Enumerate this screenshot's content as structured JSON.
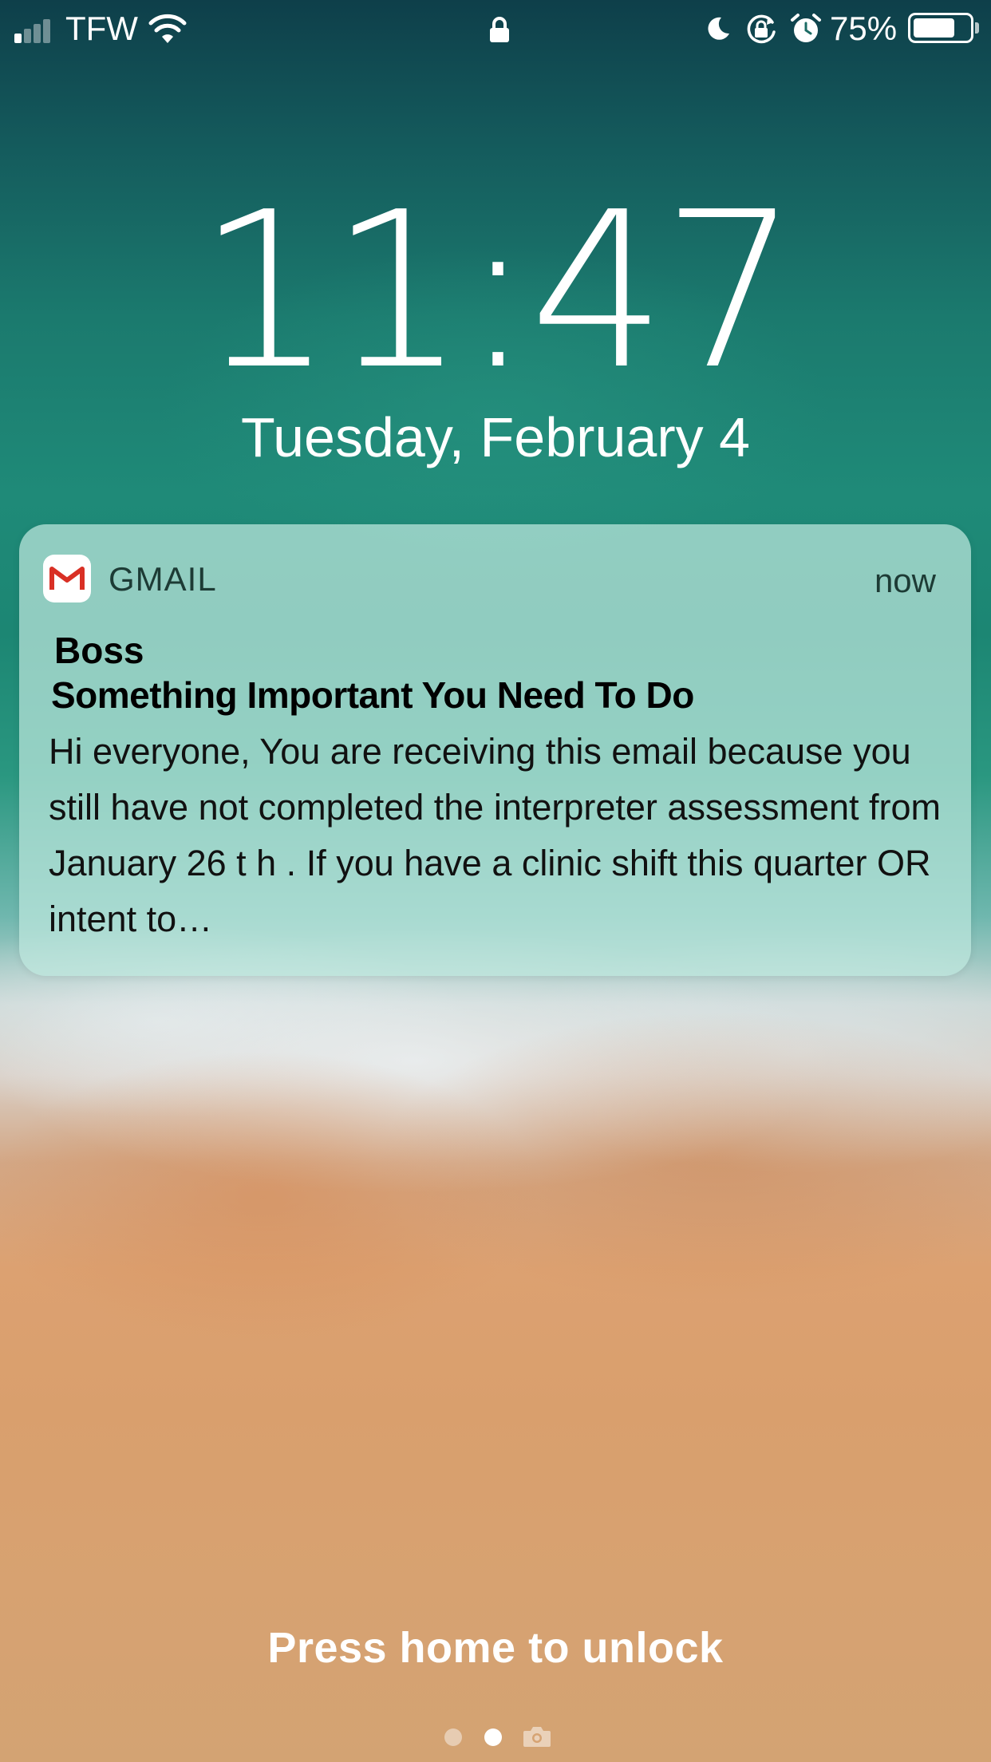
{
  "status_bar": {
    "carrier": "TFW",
    "battery_percent_label": "75%",
    "battery_level": 0.75,
    "signal_bars_filled": 1,
    "icons": [
      "signal-icon",
      "wifi-icon",
      "lock-icon",
      "moon-icon",
      "rotation-lock-icon",
      "alarm-icon",
      "battery-icon"
    ]
  },
  "lock_screen": {
    "time": "11:47",
    "date": "Tuesday, February 4",
    "unlock_hint": "Press home to unlock",
    "page_indicator": {
      "pages": 2,
      "current": 2,
      "camera_icon": "camera-icon"
    }
  },
  "notification": {
    "app_name": "GMAIL",
    "app_icon": "gmail-icon",
    "time": "now",
    "sender": "Boss",
    "subject": "Something Important You Need To Do",
    "body": "Hi everyone, You are receiving this email because you still have not completed the interpreter assessment from January 26 t h . If you have a clinic shift this quarter OR intent to…"
  },
  "colors": {
    "gmail_red": "#d93025",
    "notification_bg": "#bee8de"
  }
}
